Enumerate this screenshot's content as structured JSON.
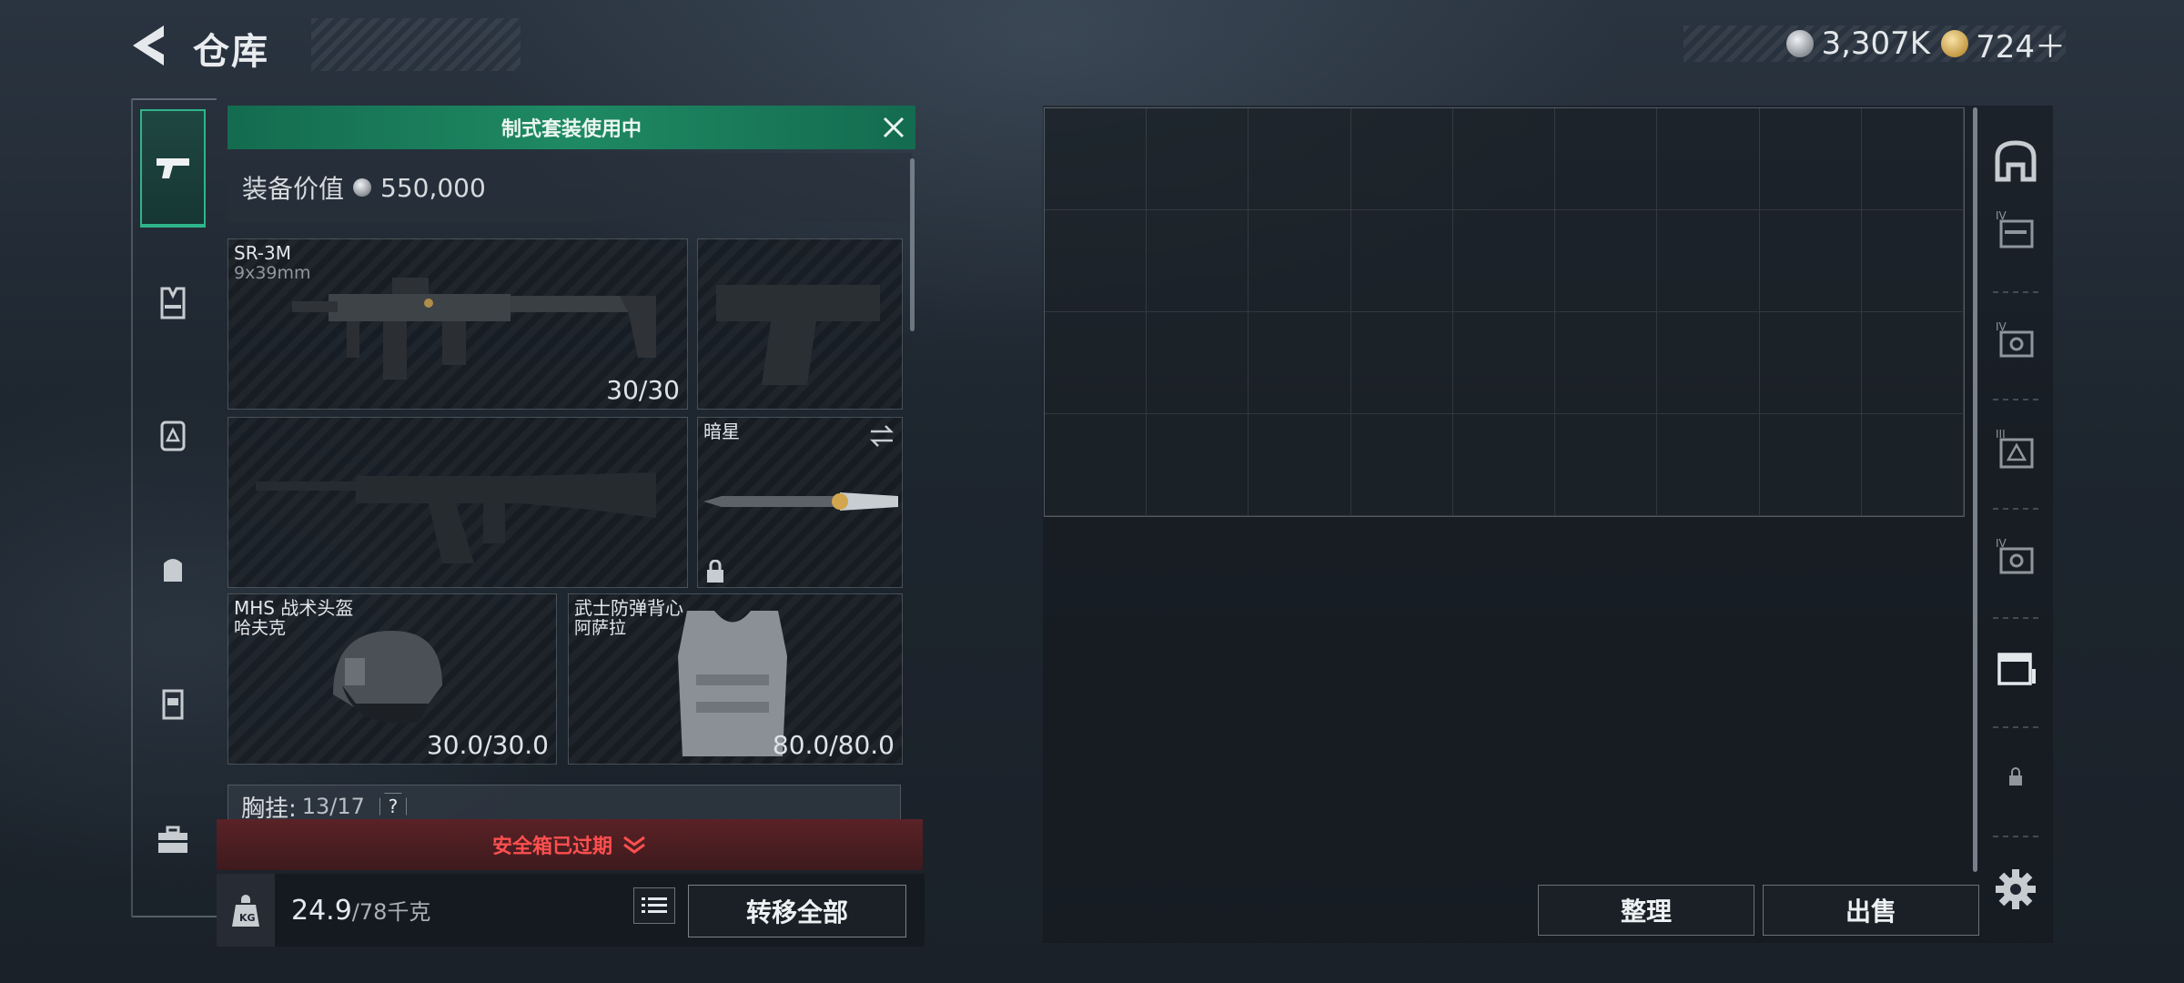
{
  "header": {
    "title": "仓库",
    "currencies": [
      {
        "icon": "silver-coin-icon",
        "value": "3,307K"
      },
      {
        "icon": "gold-coin-icon",
        "value": "724＋"
      }
    ]
  },
  "left_rail": {
    "items": [
      {
        "name": "weapons",
        "icon": "pistol-icon",
        "active": true
      },
      {
        "name": "vest",
        "icon": "chest-rig-icon",
        "active": false
      },
      {
        "name": "backpack",
        "icon": "backpack-icon",
        "active": false
      },
      {
        "name": "bag",
        "icon": "pouch-icon",
        "active": false
      },
      {
        "name": "case",
        "icon": "case-icon",
        "active": false
      },
      {
        "name": "toolbox",
        "icon": "toolbox-icon",
        "active": false
      }
    ]
  },
  "loadout": {
    "banner": "制式套装使用中",
    "value_label": "装备价值",
    "value": "550,000",
    "slots": {
      "primary": {
        "name": "SR-3M",
        "ammo_type": "9x39mm",
        "count": "30/30"
      },
      "pistol": {
        "name": "",
        "count": ""
      },
      "secondary": {
        "name": "",
        "count": ""
      },
      "melee": {
        "name": "暗星"
      },
      "helmet": {
        "name": "MHS 战术头盔",
        "variant": "哈夫克",
        "durability": "30.0/30.0"
      },
      "armor": {
        "name": "武士防弹背心",
        "variant": "阿萨拉",
        "durability": "80.0/80.0"
      }
    },
    "chest_rig": {
      "label": "胸挂:",
      "count": "13/17",
      "help": "?"
    },
    "safe_box_warning": "安全箱已过期",
    "weight": {
      "current": "24.9",
      "max": "/78千克"
    },
    "transfer_all": "转移全部"
  },
  "storage": {
    "columns": 9,
    "rows": 4
  },
  "actions": {
    "sort": "整理",
    "sell": "出售"
  },
  "colors": {
    "accent": "#1e8a63",
    "warning": "#ff4f4f"
  }
}
